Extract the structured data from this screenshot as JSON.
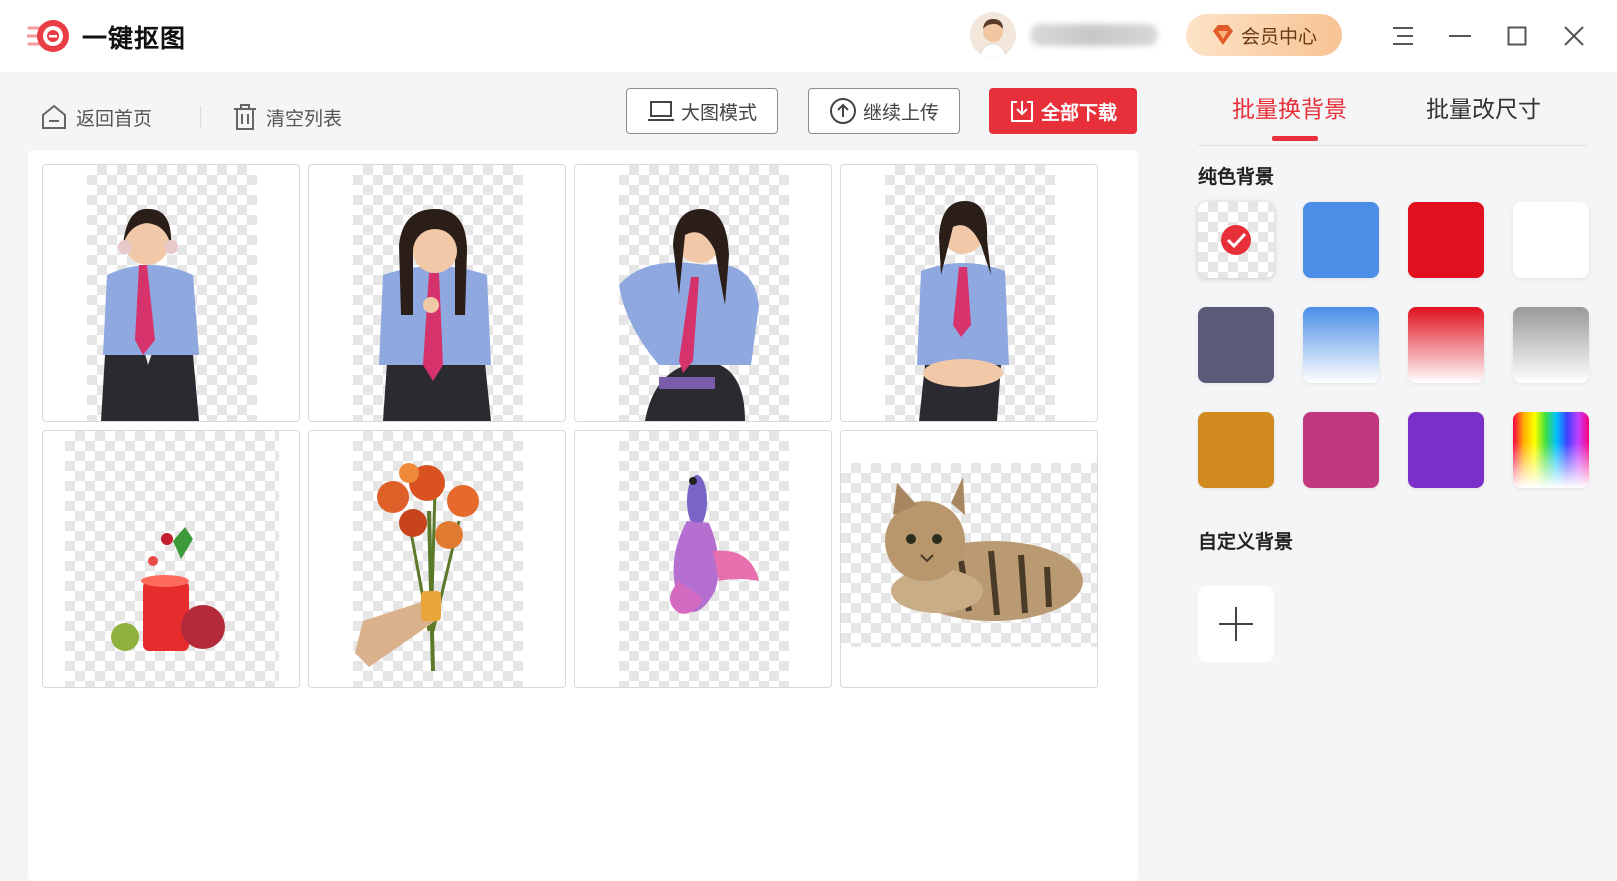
{
  "app": {
    "title": "一键抠图"
  },
  "header": {
    "vip_label": "会员中心"
  },
  "toolbar": {
    "back_label": "返回首页",
    "clear_label": "清空列表",
    "large_mode_label": "大图模式",
    "continue_upload_label": "继续上传",
    "download_all_label": "全部下载"
  },
  "thumbnails": [
    {
      "subject": "girl-hands-on-headphones"
    },
    {
      "subject": "girl-touching-chin"
    },
    {
      "subject": "girl-seated-with-book"
    },
    {
      "subject": "girl-seated-smiling"
    },
    {
      "subject": "fruit-juice-splash"
    },
    {
      "subject": "flower-bouquet-in-hand"
    },
    {
      "subject": "betta-fish"
    },
    {
      "subject": "tabby-cat"
    }
  ],
  "side_panel": {
    "tabs": [
      {
        "label": "批量换背景",
        "active": true
      },
      {
        "label": "批量改尺寸",
        "active": false
      }
    ],
    "solid_bg_title": "纯色背景",
    "custom_bg_title": "自定义背景",
    "swatches": [
      {
        "name": "transparent",
        "selected": true
      },
      {
        "name": "blue",
        "color": "#4a8ee6"
      },
      {
        "name": "red",
        "color": "#e0101e"
      },
      {
        "name": "white",
        "color": "#ffffff"
      },
      {
        "name": "slate",
        "color": "#5b5a78"
      },
      {
        "name": "blue-gradient",
        "from": "#4a8ee6",
        "to": "#ffffff"
      },
      {
        "name": "red-gradient",
        "from": "#e0101e",
        "to": "#ffffff"
      },
      {
        "name": "gray-gradient",
        "from": "#999999",
        "to": "#ffffff"
      },
      {
        "name": "amber",
        "color": "#d08a1e"
      },
      {
        "name": "magenta",
        "color": "#c2387e"
      },
      {
        "name": "purple",
        "color": "#7a2fc8"
      },
      {
        "name": "rainbow",
        "color": "multicolor"
      }
    ]
  },
  "colors": {
    "accent": "#e8303a",
    "vip_gold": "#f7c393"
  }
}
